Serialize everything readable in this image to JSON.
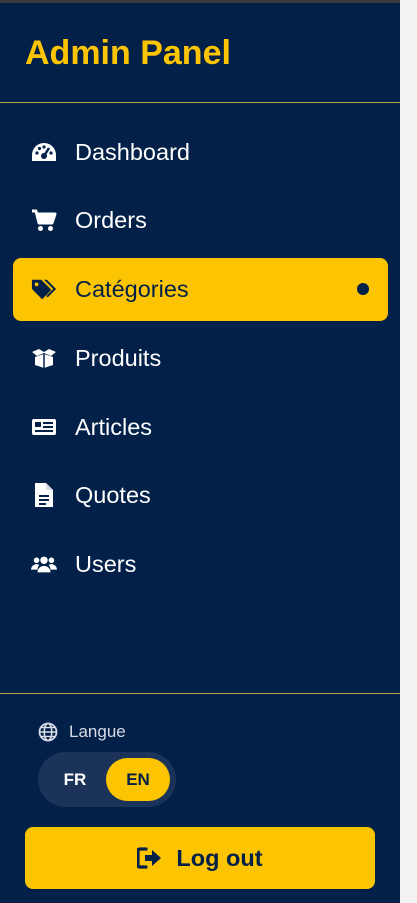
{
  "brand": {
    "title": "Admin Panel"
  },
  "nav": {
    "items": [
      {
        "label": "Dashboard",
        "icon": "gauge-icon",
        "active": false
      },
      {
        "label": "Orders",
        "icon": "shopping-cart-icon",
        "active": false
      },
      {
        "label": "Catégories",
        "icon": "tags-icon",
        "active": true
      },
      {
        "label": "Produits",
        "icon": "box-open-icon",
        "active": false
      },
      {
        "label": "Articles",
        "icon": "newspaper-icon",
        "active": false
      },
      {
        "label": "Quotes",
        "icon": "file-lines-icon",
        "active": false
      },
      {
        "label": "Users",
        "icon": "users-icon",
        "active": false
      }
    ]
  },
  "language": {
    "label": "Langue",
    "options": [
      "FR",
      "EN"
    ],
    "selected": "EN"
  },
  "logout": {
    "label": "Log out"
  },
  "colors": {
    "sidebar_bg": "#022048",
    "accent": "#fdc402",
    "text": "#ffffff"
  }
}
